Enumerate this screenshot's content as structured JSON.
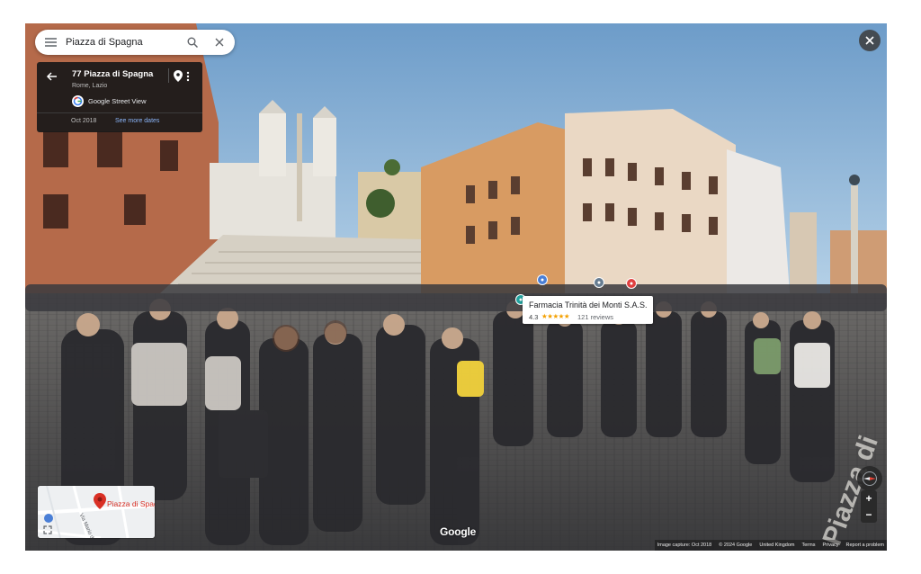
{
  "search": {
    "value": "Piazza di Spagna",
    "menu_icon": "hamburger-menu-icon",
    "search_icon": "search-icon",
    "clear_icon": "close-icon"
  },
  "info_card": {
    "title": "77 Piazza di Spagna",
    "subtitle": "Rome, Lazio",
    "source": "Google Street View",
    "date": "Oct 2018",
    "see_more": "See more dates",
    "back_icon": "back-arrow-icon",
    "pin_icon": "location-pin-icon",
    "more_icon": "more-vert-icon"
  },
  "popup": {
    "name": "Farmacia Trinità dei Monti S.A.S.",
    "rating": "4.3",
    "stars": "★★★★★",
    "reviews": "121 reviews"
  },
  "minimap": {
    "place_label": "Piazza di Spag",
    "street_label": "Via Mario de' F"
  },
  "brand": "Google",
  "footer": {
    "capture": "Image capture: Oct 2018",
    "copyright": "© 2024 Google",
    "region": "United Kingdom",
    "terms": "Terms",
    "privacy": "Privacy",
    "report": "Report a problem"
  },
  "controls": {
    "zoom_in": "+",
    "zoom_out": "−",
    "compass_icon": "compass-icon",
    "close_icon": "close-icon",
    "expand_icon": "expand-icon"
  },
  "colors": {
    "accent_link": "#8ab4f8",
    "star": "#f4a000",
    "pin_red": "#d93025"
  }
}
